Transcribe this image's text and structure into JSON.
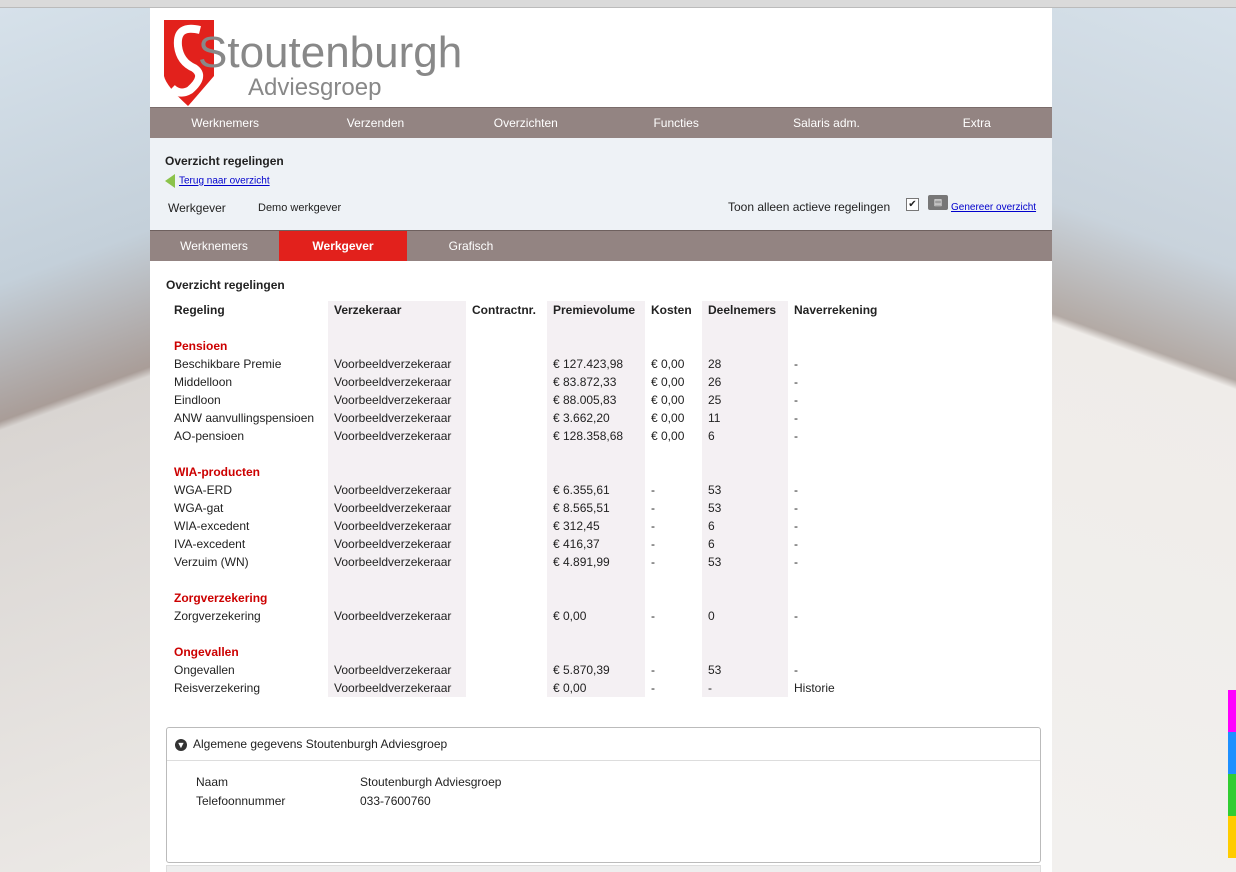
{
  "logo": {
    "big": "Stoutenburgh",
    "small": "Adviesgroep"
  },
  "nav": [
    "Werknemers",
    "Verzenden",
    "Overzichten",
    "Functies",
    "Salaris adm.",
    "Extra"
  ],
  "header": {
    "title": "Overzicht regelingen",
    "back_link": "Terug naar overzicht",
    "werkgever_label": "Werkgever",
    "werkgever_value": "Demo werkgever",
    "toon_label": "Toon alleen actieve regelingen",
    "toon_checked": true,
    "generate_link": "Genereer overzicht"
  },
  "tabs": [
    "Werknemers",
    "Werkgever",
    "Grafisch"
  ],
  "active_tab": "Werkgever",
  "section_title": "Overzicht regelingen",
  "columns": [
    "Regeling",
    "Verzekeraar",
    "Contractnr.",
    "Premievolume",
    "Kosten",
    "Deelnemers",
    "Naverrekening"
  ],
  "groups": [
    {
      "name": "Pensioen",
      "rows": [
        {
          "regeling": "Beschikbare Premie",
          "verzekeraar": "Voorbeeldverzekeraar",
          "contract": "",
          "premie": "€ 127.423,98",
          "kosten": "€ 0,00",
          "deelnemers": "28",
          "naverrekening": "-"
        },
        {
          "regeling": "Middelloon",
          "verzekeraar": "Voorbeeldverzekeraar",
          "contract": "",
          "premie": "€ 83.872,33",
          "kosten": "€ 0,00",
          "deelnemers": "26",
          "naverrekening": "-"
        },
        {
          "regeling": "Eindloon",
          "verzekeraar": "Voorbeeldverzekeraar",
          "contract": "",
          "premie": "€ 88.005,83",
          "kosten": "€ 0,00",
          "deelnemers": "25",
          "naverrekening": "-"
        },
        {
          "regeling": "ANW aanvullingspensioen",
          "verzekeraar": "Voorbeeldverzekeraar",
          "contract": "",
          "premie": "€ 3.662,20",
          "kosten": "€ 0,00",
          "deelnemers": "11",
          "naverrekening": "-"
        },
        {
          "regeling": "AO-pensioen",
          "verzekeraar": "Voorbeeldverzekeraar",
          "contract": "",
          "premie": "€ 128.358,68",
          "kosten": "€ 0,00",
          "deelnemers": "6",
          "naverrekening": "-"
        }
      ]
    },
    {
      "name": "WIA-producten",
      "rows": [
        {
          "regeling": "WGA-ERD",
          "verzekeraar": "Voorbeeldverzekeraar",
          "contract": "",
          "premie": "€ 6.355,61",
          "kosten": "-",
          "deelnemers": "53",
          "naverrekening": "-"
        },
        {
          "regeling": "WGA-gat",
          "verzekeraar": "Voorbeeldverzekeraar",
          "contract": "",
          "premie": "€ 8.565,51",
          "kosten": "-",
          "deelnemers": "53",
          "naverrekening": "-"
        },
        {
          "regeling": "WIA-excedent",
          "verzekeraar": "Voorbeeldverzekeraar",
          "contract": "",
          "premie": "€ 312,45",
          "kosten": "-",
          "deelnemers": "6",
          "naverrekening": "-"
        },
        {
          "regeling": "IVA-excedent",
          "verzekeraar": "Voorbeeldverzekeraar",
          "contract": "",
          "premie": "€ 416,37",
          "kosten": "-",
          "deelnemers": "6",
          "naverrekening": "-"
        },
        {
          "regeling": "Verzuim (WN)",
          "verzekeraar": "Voorbeeldverzekeraar",
          "contract": "",
          "premie": "€ 4.891,99",
          "kosten": "-",
          "deelnemers": "53",
          "naverrekening": "-"
        }
      ]
    },
    {
      "name": "Zorgverzekering",
      "rows": [
        {
          "regeling": "Zorgverzekering",
          "verzekeraar": "Voorbeeldverzekeraar",
          "contract": "",
          "premie": "€ 0,00",
          "kosten": "-",
          "deelnemers": "0",
          "naverrekening": "-"
        }
      ]
    },
    {
      "name": "Ongevallen",
      "rows": [
        {
          "regeling": "Ongevallen",
          "verzekeraar": "Voorbeeldverzekeraar",
          "contract": "",
          "premie": "€ 5.870,39",
          "kosten": "-",
          "deelnemers": "53",
          "naverrekening": "-"
        },
        {
          "regeling": "Reisverzekering",
          "verzekeraar": "Voorbeeldverzekeraar",
          "contract": "",
          "premie": "€ 0,00",
          "kosten": "-",
          "deelnemers": "-",
          "naverrekening": "Historie"
        }
      ]
    }
  ],
  "general": {
    "title": "Algemene gegevens Stoutenburgh Adviesgroep",
    "naam_label": "Naam",
    "naam_value": "Stoutenburgh Adviesgroep",
    "tel_label": "Telefoonnummer",
    "tel_value": "033-7600760"
  },
  "colors": {
    "accent": "#e2211c",
    "nav": "#938482",
    "link": "#0000cc",
    "group": "#cc0000"
  },
  "icons": {
    "back": "back-arrow-icon",
    "generate": "document-icon",
    "expand": "chevron-down-circle-icon"
  }
}
